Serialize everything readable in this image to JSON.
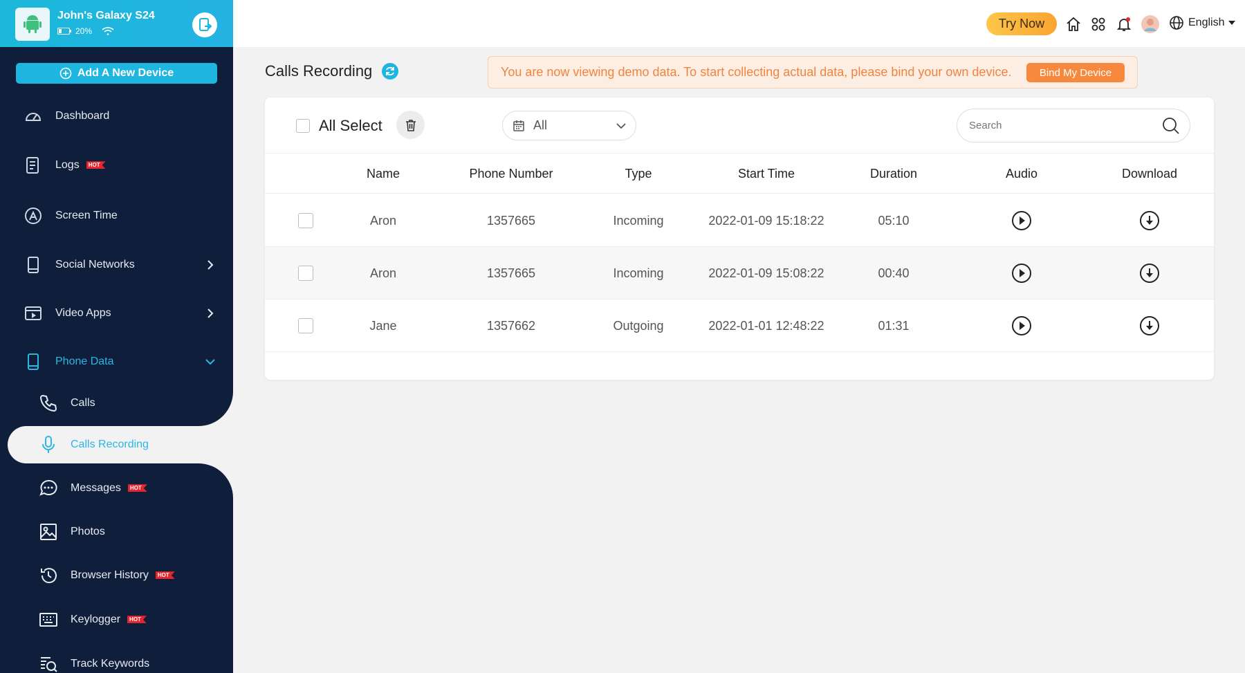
{
  "device": {
    "name": "John's Galaxy S24",
    "battery": "20%"
  },
  "sidebar": {
    "add_device": "Add A New Device",
    "items": [
      {
        "label": "Dashboard"
      },
      {
        "label": "Logs",
        "badge": "HOT"
      },
      {
        "label": "Screen Time"
      },
      {
        "label": "Social Networks"
      },
      {
        "label": "Video Apps"
      },
      {
        "label": "Phone Data"
      }
    ],
    "sub_items": [
      {
        "label": "Calls"
      },
      {
        "label": "Calls Recording"
      },
      {
        "label": "Messages",
        "badge": "HOT"
      },
      {
        "label": "Photos"
      },
      {
        "label": "Browser History",
        "badge": "HOT"
      },
      {
        "label": "Keylogger",
        "badge": "HOT"
      },
      {
        "label": "Track Keywords"
      }
    ]
  },
  "topbar": {
    "try_now": "Try Now",
    "language": "English"
  },
  "page": {
    "title": "Calls Recording"
  },
  "banner": {
    "text": "You are now viewing demo data. To start collecting actual data, please bind your own device.",
    "button": "Bind My Device"
  },
  "toolbar": {
    "all_select": "All Select",
    "filter_value": "All",
    "search_placeholder": "Search"
  },
  "table": {
    "headers": {
      "name": "Name",
      "phone": "Phone Number",
      "type": "Type",
      "start": "Start Time",
      "duration": "Duration",
      "audio": "Audio",
      "download": "Download"
    },
    "rows": [
      {
        "name": "Aron",
        "phone": "1357665",
        "type": "Incoming",
        "start": "2022-01-09 15:18:22",
        "duration": "05:10"
      },
      {
        "name": "Aron",
        "phone": "1357665",
        "type": "Incoming",
        "start": "2022-01-09 15:08:22",
        "duration": "00:40"
      },
      {
        "name": "Jane",
        "phone": "1357662",
        "type": "Outgoing",
        "start": "2022-01-01 12:48:22",
        "duration": "01:31"
      }
    ]
  },
  "colors": {
    "sidebar_bg": "#0f1e3a",
    "accent": "#1eb6e0",
    "warning": "#f6893d",
    "hot": "#e8242c"
  },
  "icons": [
    "android-icon",
    "battery-icon",
    "wifi-icon",
    "switch-device-icon",
    "plus-circle-icon",
    "dashboard-icon",
    "logs-icon",
    "screen-time-icon",
    "social-icon",
    "video-icon",
    "phone-icon",
    "call-icon",
    "mic-icon",
    "message-icon",
    "photo-icon",
    "history-icon",
    "keyboard-icon",
    "keywords-icon",
    "home-icon",
    "apps-icon",
    "bell-icon",
    "globe-icon",
    "refresh-icon",
    "trash-icon",
    "calendar-icon",
    "search-icon",
    "play-icon",
    "download-icon"
  ]
}
